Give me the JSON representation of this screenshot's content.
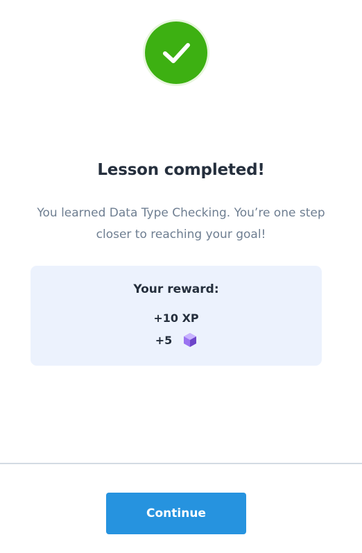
{
  "status": {
    "icon": "checkmark-icon",
    "color": "#3db012"
  },
  "lesson": {
    "title": "Lesson completed!",
    "message": "You learned Data Type Checking. You’re one step closer to reaching your goal!"
  },
  "reward": {
    "title": "Your reward:",
    "xp": "+10 XP",
    "gems": "+5",
    "gem_icon": "purple-gem-icon",
    "card_color": "#ecf2fd"
  },
  "footer": {
    "continue_label": "Continue",
    "button_color": "#2693df"
  }
}
